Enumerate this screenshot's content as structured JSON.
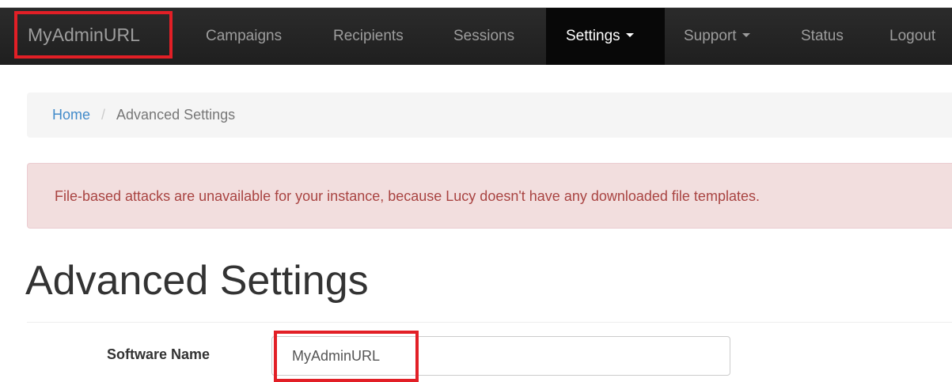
{
  "navbar": {
    "brand": "MyAdminURL",
    "items": [
      {
        "label": "Campaigns"
      },
      {
        "label": "Recipients"
      },
      {
        "label": "Sessions"
      },
      {
        "label": "Settings"
      },
      {
        "label": "Support"
      },
      {
        "label": "Status"
      },
      {
        "label": "Logout"
      }
    ],
    "active_item": "Settings"
  },
  "breadcrumb": {
    "home": "Home",
    "separator": "/",
    "current": "Advanced Settings"
  },
  "alert": {
    "message": "File-based attacks are unavailable for your instance, because Lucy doesn't have any downloaded file templates."
  },
  "page": {
    "title": "Advanced Settings"
  },
  "form": {
    "software_name_label": "Software Name",
    "software_name_value": "MyAdminURL"
  },
  "colors": {
    "navbar_bg": "#222222",
    "highlight": "#e21f26",
    "link": "#428bca",
    "alert_text": "#a94442",
    "alert_bg": "#f2dede"
  },
  "icons": {
    "dropdown": "caret-down-icon"
  }
}
